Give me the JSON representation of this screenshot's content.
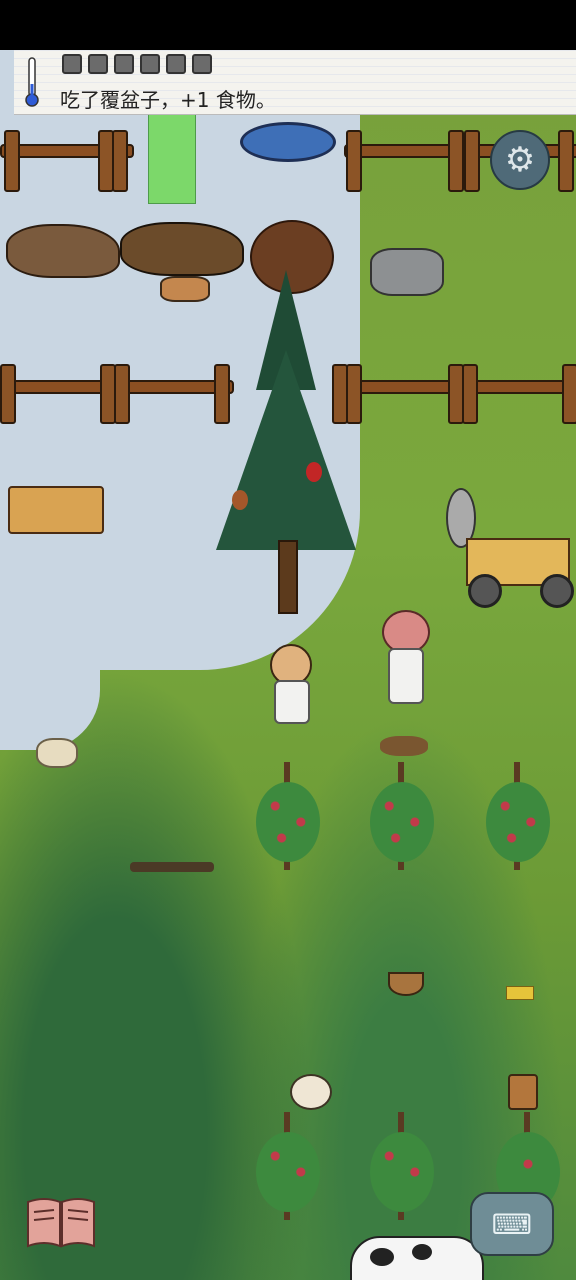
{
  "hud": {
    "message": "吃了覆盆子，+1 食物。",
    "food_slots_visible": 6
  },
  "icons": {
    "settings": "gear-icon",
    "book": "book-icon",
    "chat": "keyboard-chat-icon"
  }
}
